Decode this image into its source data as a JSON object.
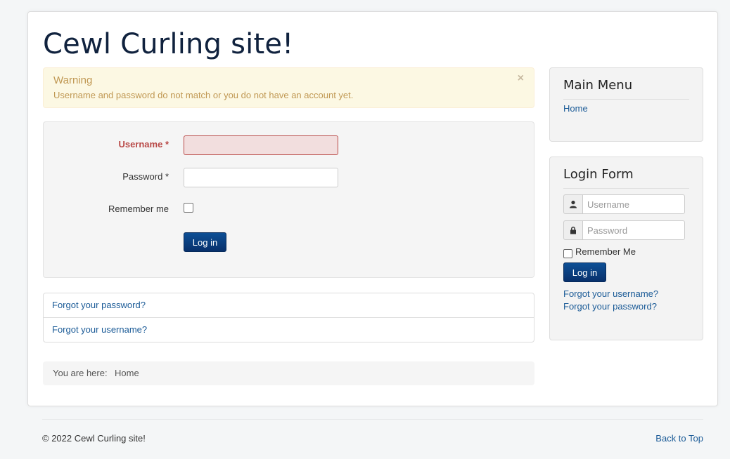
{
  "site": {
    "title": "Cewl Curling site!"
  },
  "alert": {
    "heading": "Warning",
    "message": "Username and password do not match or you do not have an account yet.",
    "close_symbol": "×"
  },
  "login_form": {
    "username_label": "Username",
    "password_label": "Password",
    "required_mark": " *",
    "remember_label": "Remember me",
    "username_value": "",
    "password_value": "",
    "remember_checked": false,
    "submit_label": "Log in"
  },
  "help_links": {
    "forgot_password": "Forgot your password?",
    "forgot_username": "Forgot your username?"
  },
  "breadcrumb": {
    "label": "You are here:",
    "home": "Home"
  },
  "sidebar": {
    "main_menu": {
      "title": "Main Menu",
      "items": [
        {
          "label": "Home"
        }
      ]
    },
    "login_module": {
      "title": "Login Form",
      "username_placeholder": "Username",
      "password_placeholder": "Password",
      "remember_label": "Remember Me",
      "submit_label": "Log in",
      "forgot_username": "Forgot your username?",
      "forgot_password": "Forgot your password?",
      "user_icon": "user-icon",
      "lock_icon": "lock-icon"
    }
  },
  "footer": {
    "copyright": "© 2022 Cewl Curling site!",
    "back_to_top": "Back to Top"
  },
  "colors": {
    "brand_title": "#10223e",
    "link": "#1b5b97",
    "button": "#0a4080",
    "error": "#b94a48",
    "warning_text": "#c09853",
    "warning_bg": "#fcf8e3"
  }
}
